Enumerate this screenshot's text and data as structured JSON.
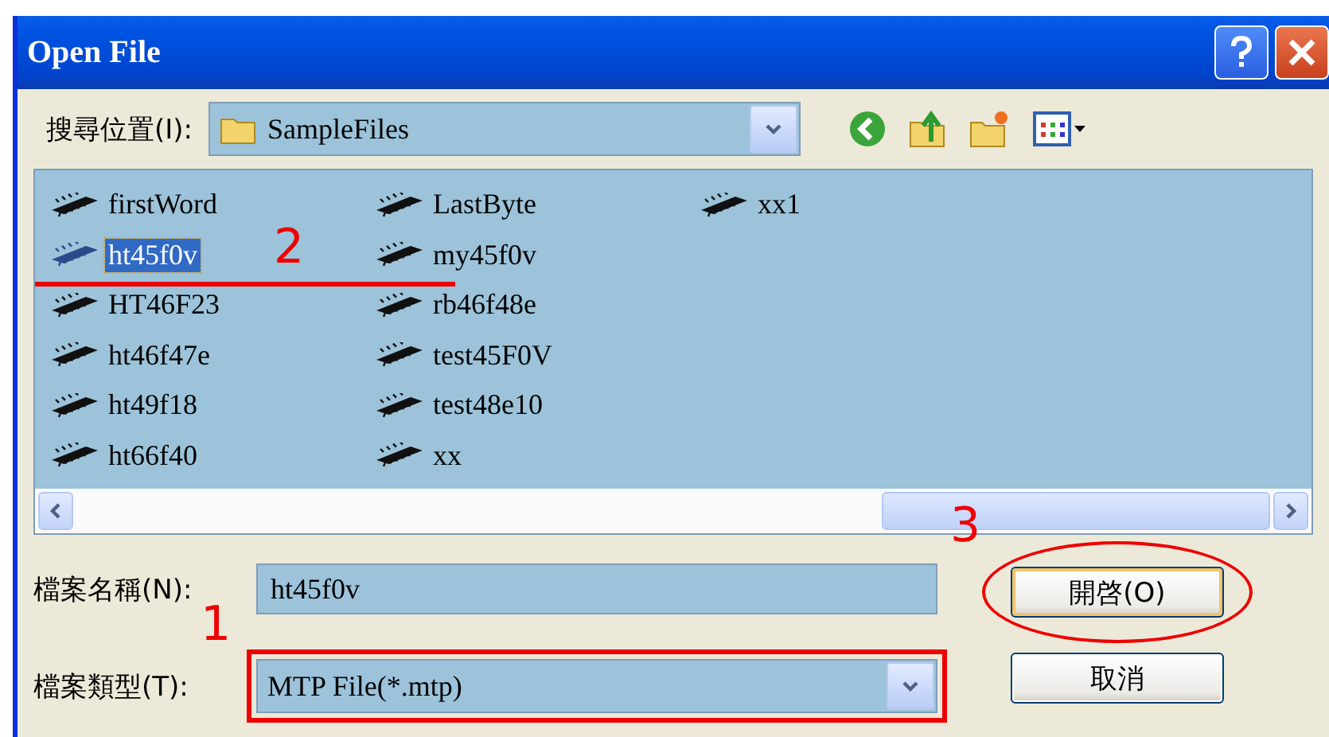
{
  "window": {
    "title": "Open File"
  },
  "look_in": {
    "label": "搜尋位置(I):",
    "value": "SampleFiles"
  },
  "files": [
    {
      "name": "firstWord",
      "selected": false
    },
    {
      "name": "ht45f0v",
      "selected": true,
      "annotation": "2"
    },
    {
      "name": "HT46F23",
      "selected": false
    },
    {
      "name": "ht46f47e",
      "selected": false
    },
    {
      "name": "ht49f18",
      "selected": false
    },
    {
      "name": "ht66f40",
      "selected": false
    },
    {
      "name": "LastByte",
      "selected": false
    },
    {
      "name": "my45f0v",
      "selected": false
    },
    {
      "name": "rb46f48e",
      "selected": false
    },
    {
      "name": "test45F0V",
      "selected": false
    },
    {
      "name": "test48e10",
      "selected": false
    },
    {
      "name": "xx",
      "selected": false
    },
    {
      "name": "xx1",
      "selected": false
    }
  ],
  "file_name": {
    "label": "檔案名稱(N):",
    "value": "ht45f0v"
  },
  "file_type": {
    "label": "檔案類型(T):",
    "value": "MTP File(*.mtp)",
    "annotation": "1"
  },
  "buttons": [
    {
      "label": "開啓(O)",
      "default": true,
      "annotation": "3"
    },
    {
      "label": "取消",
      "default": false
    }
  ]
}
